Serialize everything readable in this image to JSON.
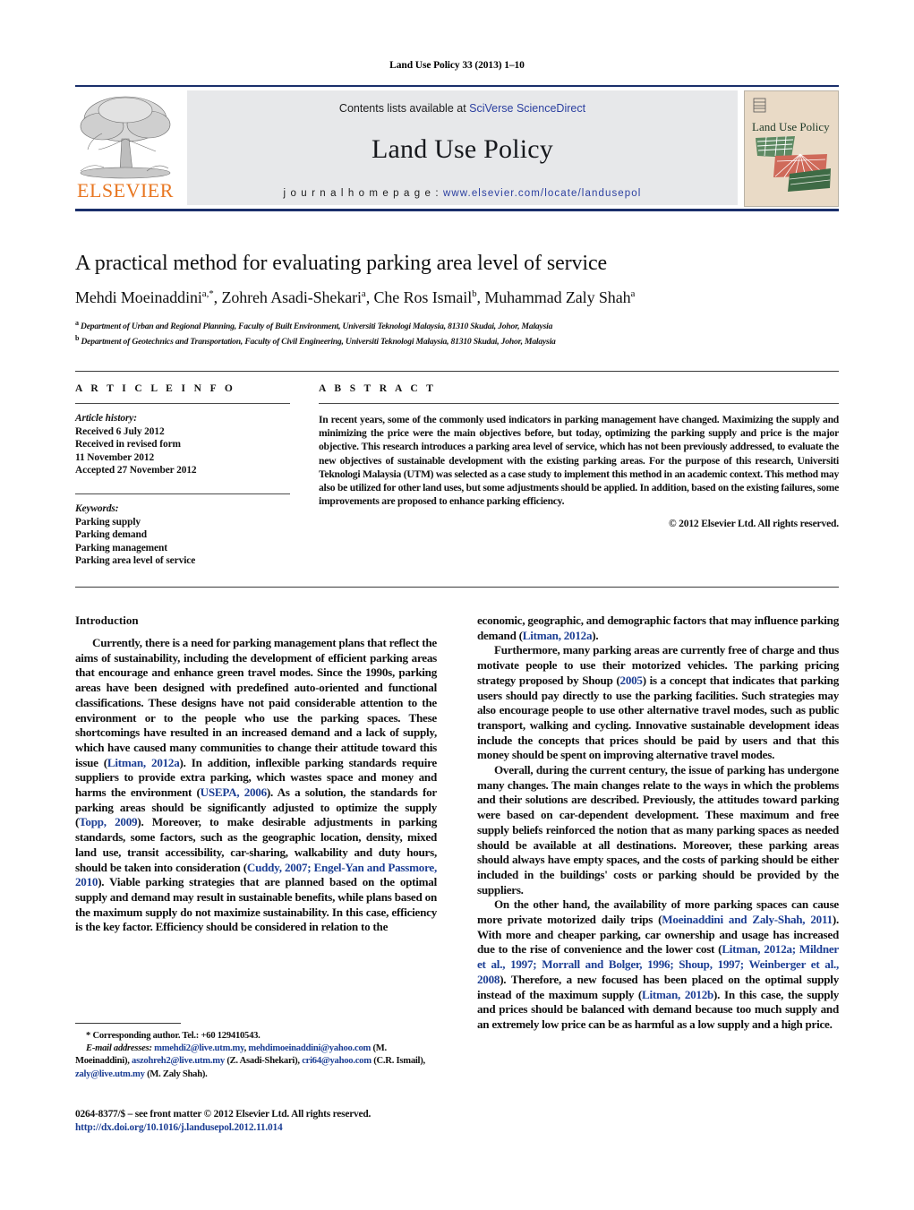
{
  "running_head": "Land Use Policy 33 (2013) 1–10",
  "masthead": {
    "contents_prefix": "Contents lists available at ",
    "contents_link": "SciVerse ScienceDirect",
    "journal_title": "Land Use Policy",
    "homepage_prefix": "j o u r n a l   h o m e p a g e :  ",
    "homepage_url": "www.elsevier.com/locate/landusepol",
    "publisher_word": "ELSEVIER",
    "cover_title": "Land Use Policy"
  },
  "article": {
    "title": "A practical method for evaluating parking area level of service",
    "authors_html": "Mehdi Moeinaddini<sup>a,*</sup>, Zohreh Asadi-Shekari<sup>a</sup>, Che Ros Ismail<sup>b</sup>, Muhammad Zaly Shah<sup>a</sup>",
    "affiliation_a": "Department of Urban and Regional Planning, Faculty of Built Environment, Universiti Teknologi Malaysia, 81310 Skudai, Johor, Malaysia",
    "affiliation_b": "Department of Geotechnics and Transportation, Faculty of Civil Engineering, Universiti Teknologi Malaysia, 81310 Skudai, Johor, Malaysia"
  },
  "info": {
    "heading": "A R T I C L E   I N F O",
    "history_label": "Article history:",
    "history_lines": [
      "Received 6 July 2012",
      "Received in revised form",
      "11 November 2012",
      "Accepted 27 November 2012"
    ],
    "keywords_label": "Keywords:",
    "keywords": [
      "Parking supply",
      "Parking demand",
      "Parking management",
      "Parking area level of service"
    ]
  },
  "abstract": {
    "heading": "A B S T R A C T",
    "text": "In recent years, some of the commonly used indicators in parking management have changed. Maximizing the supply and minimizing the price were the main objectives before, but today, optimizing the parking supply and price is the major objective. This research introduces a parking area level of service, which has not been previously addressed, to evaluate the new objectives of sustainable development with the existing parking areas. For the purpose of this research, Universiti Teknologi Malaysia (UTM) was selected as a case study to implement this method in an academic context. This method may also be utilized for other land uses, but some adjustments should be applied. In addition, based on the existing failures, some improvements are proposed to enhance parking efficiency.",
    "copyright": "© 2012 Elsevier Ltd. All rights reserved."
  },
  "body": {
    "intro_heading": "Introduction",
    "left_paragraphs": [
      "Currently, there is a need for parking management plans that reflect the aims of sustainability, including the development of efficient parking areas that encourage and enhance green travel modes. Since the 1990s, parking areas have been designed with predefined auto-oriented and functional classifications. These designs have not paid considerable attention to the environment or to the people who use the parking spaces. These shortcomings have resulted in an increased demand and a lack of supply, which have caused many communities to change their attitude toward this issue (Litman, 2012a). In addition, inflexible parking standards require suppliers to provide extra parking, which wastes space and money and harms the environment (USEPA, 2006). As a solution, the standards for parking areas should be significantly adjusted to optimize the supply (Topp, 2009). Moreover, to make desirable adjustments in parking standards, some factors, such as the geographic location, density, mixed land use, transit accessibility, car-sharing, walkability and duty hours, should be taken into consideration (Cuddy, 2007; Engel-Yan and Passmore, 2010). Viable parking strategies that are planned based on the optimal supply and demand may result in sustainable benefits, while plans based on the maximum supply do not maximize sustainability. In this case, efficiency is the key factor. Efficiency should be considered in relation to the"
    ],
    "right_paragraphs": [
      "economic, geographic, and demographic factors that may influence parking demand (Litman, 2012a).",
      "Furthermore, many parking areas are currently free of charge and thus motivate people to use their motorized vehicles. The parking pricing strategy proposed by Shoup (2005) is a concept that indicates that parking users should pay directly to use the parking facilities. Such strategies may also encourage people to use other alternative travel modes, such as public transport, walking and cycling. Innovative sustainable development ideas include the concepts that prices should be paid by users and that this money should be spent on improving alternative travel modes.",
      "Overall, during the current century, the issue of parking has undergone many changes. The main changes relate to the ways in which the problems and their solutions are described. Previously, the attitudes toward parking were based on car-dependent development. These maximum and free supply beliefs reinforced the notion that as many parking spaces as needed should be available at all destinations. Moreover, these parking areas should always have empty spaces, and the costs of parking should be either included in the buildings' costs or parking should be provided by the suppliers.",
      "On the other hand, the availability of more parking spaces can cause more private motorized daily trips (Moeinaddini and Zaly-Shah, 2011). With more and cheaper parking, car ownership and usage has increased due to the rise of convenience and the lower cost (Litman, 2012a; Mildner et al., 1997; Morrall and Bolger, 1996; Shoup, 1997; Weinberger et al., 2008). Therefore, a new focused has been placed on the optimal supply instead of the maximum supply (Litman, 2012b). In this case, the supply and prices should be balanced with demand because too much supply and an extremely low price can be as harmful as a low supply and a high price."
    ]
  },
  "footnotes": {
    "corresponding": "* Corresponding author. Tel.: +60 129410543.",
    "email_label": "E-mail addresses:",
    "emails_line1_a": "mmehdi2@live.utm.my",
    "emails_line1_b": "mehdimoeinaddini@yahoo.com",
    "emails_line2_name": "(M. Moeinaddini),",
    "emails_line2_a": "aszohreh2@live.utm.my",
    "emails_line2_b": "(Z. Asadi-Shekari),",
    "emails_line2_c": "cri64@yahoo.com",
    "emails_line3_name": "(C.R. Ismail),",
    "emails_line3_a": "zaly@live.utm.my",
    "emails_line3_b": "(M. Zaly Shah).",
    "issn_line": "0264-8377/$ – see front matter © 2012 Elsevier Ltd. All rights reserved.",
    "doi_line": "http://dx.doi.org/10.1016/j.landusepol.2012.11.014"
  },
  "colors": {
    "rule_navy": "#1a2f6b",
    "link_blue": "#2b3fa0",
    "cite_blue": "#1d3f94",
    "elsevier_orange": "#e87722",
    "masthead_grey": "#e7e8ea"
  }
}
